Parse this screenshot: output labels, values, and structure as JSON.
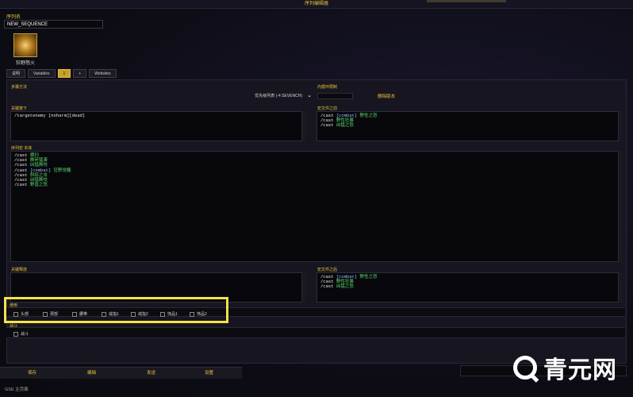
{
  "window": {
    "title": "序列编辑器"
  },
  "sequence": {
    "name_label": "序列名",
    "name_value": "NEW_SEQUENCE",
    "icon_label": "狂野怒火"
  },
  "tabs": [
    {
      "label": "说明"
    },
    {
      "label": "Variables"
    },
    {
      "label": "1"
    },
    {
      "label": "+"
    },
    {
      "label": "Websites"
    }
  ],
  "step_function": {
    "label": "步骤方法",
    "value": "优先级列表 (-4 SEVENCH)"
  },
  "inner_loop": {
    "label": "内循环限制",
    "button": "删除版本"
  },
  "keypress": {
    "label": "关键按下",
    "lines": [
      "/targetenemy [noharm][dead]"
    ]
  },
  "pre_macro": {
    "label": "宏文件之前",
    "lines": [
      {
        "cmd": "/cast ",
        "cond": "[combat]",
        "spell": " 野性之怒"
      },
      {
        "cmd": "/cast ",
        "cond": "",
        "spell": "野性狂暴"
      },
      {
        "cmd": "/cast ",
        "cond": "",
        "spell": "凶猛之怒"
      }
    ]
  },
  "main_macro": {
    "label": "序列宏 本体",
    "lines": [
      {
        "cmd": "/cast ",
        "cond": "",
        "spell": "横扫"
      },
      {
        "cmd": "/cast ",
        "cond": "",
        "spell": "撕碎猛袭"
      },
      {
        "cmd": "/cast ",
        "cond": "",
        "spell": "凶猛撕咬"
      },
      {
        "cmd": "/cast ",
        "cond": "[combat]",
        "spell": " 狂野觉醒"
      },
      {
        "cmd": "/cast ",
        "cond": "",
        "spell": "斜掠之击"
      },
      {
        "cmd": "/cast ",
        "cond": "",
        "spell": "凶猛撕咬"
      },
      {
        "cmd": "/cast ",
        "cond": "",
        "spell": "野兽之怒"
      }
    ]
  },
  "keyrelease": {
    "label": "关键释放"
  },
  "post_macro": {
    "label": "宏文件之后",
    "lines": [
      {
        "cmd": "/cast ",
        "cond": "[combat]",
        "spell": " 野性之怒"
      },
      {
        "cmd": "/cast ",
        "cond": "",
        "spell": "野性狂暴"
      },
      {
        "cmd": "/cast ",
        "cond": "",
        "spell": "凶猛之怒"
      }
    ]
  },
  "use_section": {
    "label": "使用",
    "options": [
      "头部",
      "颈部",
      "腰带",
      "戒指1",
      "戒指2",
      "饰品1",
      "饰品2"
    ]
  },
  "combat_section": {
    "label": "战斗",
    "options": [
      "战斗"
    ]
  },
  "bottom_buttons": [
    "保存",
    "编辑",
    "发送",
    "设置"
  ],
  "status": "GSE 主页面"
}
